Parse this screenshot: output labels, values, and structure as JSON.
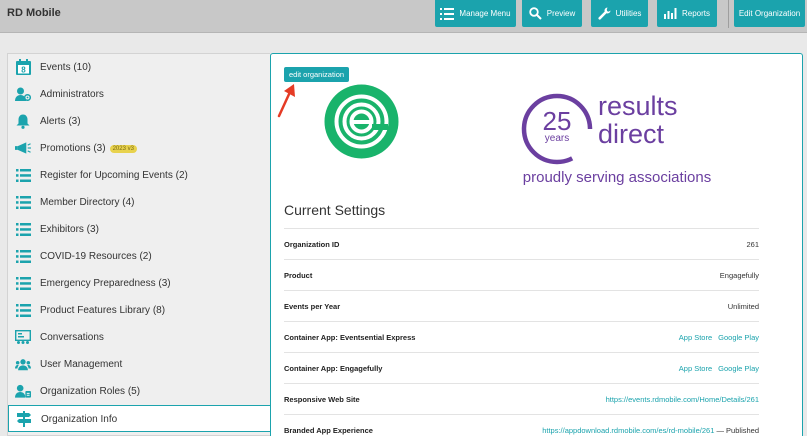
{
  "header": {
    "app_title": "RD Mobile",
    "buttons": {
      "manage_menu": "Manage Menu",
      "preview": "Preview",
      "utilities": "Utilities",
      "reports": "Reports",
      "edit_organization": "Edit Organization"
    }
  },
  "sidebar": {
    "items": [
      {
        "label": "Events (10)",
        "icon": "calendar-icon"
      },
      {
        "label": "Administrators",
        "icon": "admin-user-icon"
      },
      {
        "label": "Alerts (3)",
        "icon": "bell-icon"
      },
      {
        "label": "Promotions (3)",
        "icon": "megaphone-icon",
        "badge": "2023 v3"
      },
      {
        "label": "Register for Upcoming Events (2)",
        "icon": "list-icon"
      },
      {
        "label": "Member Directory (4)",
        "icon": "list-icon"
      },
      {
        "label": "Exhibitors (3)",
        "icon": "list-icon"
      },
      {
        "label": "COVID-19 Resources (2)",
        "icon": "list-icon"
      },
      {
        "label": "Emergency Preparedness (3)",
        "icon": "list-icon"
      },
      {
        "label": "Product Features Library (8)",
        "icon": "list-icon"
      },
      {
        "label": "Conversations",
        "icon": "conversation-icon"
      },
      {
        "label": "User Management",
        "icon": "users-icon"
      },
      {
        "label": "Organization Roles (5)",
        "icon": "roles-icon"
      },
      {
        "label": "Organization Info",
        "icon": "signpost-icon"
      }
    ],
    "active_index": 13
  },
  "main": {
    "edit_button": "edit organization",
    "logo_right": {
      "number": "25",
      "years": "years",
      "line1": "results",
      "line2": "direct",
      "tagline": "proudly serving associations"
    },
    "section_title": "Current Settings",
    "settings": {
      "org_id": {
        "label": "Organization ID",
        "value": "261"
      },
      "product": {
        "label": "Product",
        "value": "Engagefully"
      },
      "events_per_year": {
        "label": "Events per Year",
        "value": "Unlimited"
      },
      "container_express": {
        "label": "Container App: Eventsential Express",
        "app_store": "App Store",
        "google_play": "Google Play"
      },
      "container_engagefully": {
        "label": "Container App: Engagefully",
        "app_store": "App Store",
        "google_play": "Google Play"
      },
      "responsive_web": {
        "label": "Responsive Web Site",
        "url": "https://events.rdmobile.com/Home/Details/261"
      },
      "branded_app": {
        "label": "Branded App Experience",
        "url": "https://appdownload.rdmobile.com/es/rd-mobile/261",
        "status": "— Published"
      }
    }
  },
  "colors": {
    "accent": "#1ba3ad",
    "topbar": "#c8c8c8",
    "logo_green": "#19b36b",
    "logo_purple": "#6b3fa0"
  }
}
